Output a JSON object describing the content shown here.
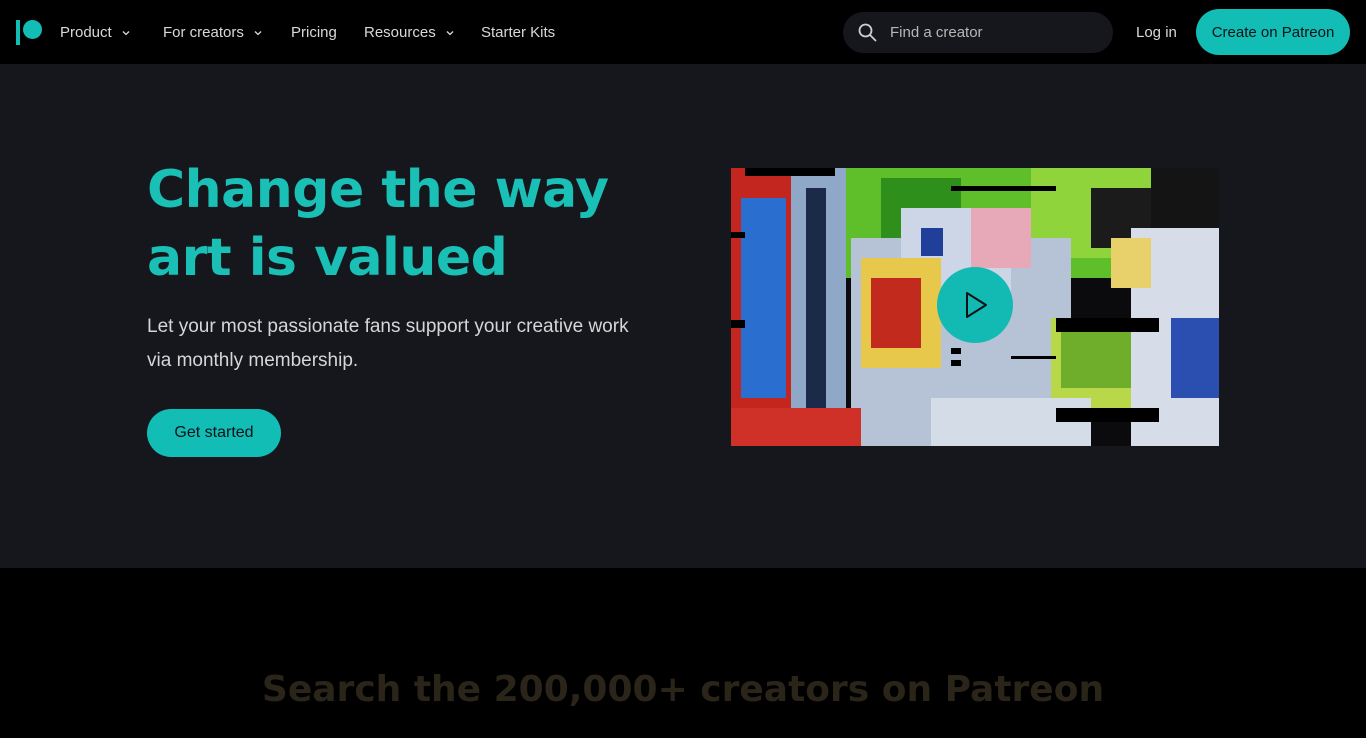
{
  "nav": {
    "items": [
      {
        "label": "Product",
        "has_dropdown": true
      },
      {
        "label": "For creators",
        "has_dropdown": true
      },
      {
        "label": "Pricing",
        "has_dropdown": false
      },
      {
        "label": "Resources",
        "has_dropdown": true
      },
      {
        "label": "Starter Kits",
        "has_dropdown": false
      }
    ],
    "search_placeholder": "Find a creator",
    "login_label": "Log in",
    "create_label": "Create on Patreon"
  },
  "hero": {
    "title": "Change the way art is valued",
    "subtitle": "Let your most passionate fans support your creative work via monthly membership.",
    "cta_label": "Get started"
  },
  "search_section": {
    "heading": "Search the 200,000+ creators on Patreon"
  },
  "colors": {
    "brand_teal": "#11bdb5",
    "hero_bg": "#16171c",
    "page_bg": "#000000"
  },
  "icons": {
    "logo": "patreon-logo-icon",
    "search": "search-icon",
    "dropdown": "chevron-down-icon",
    "play": "play-icon"
  }
}
